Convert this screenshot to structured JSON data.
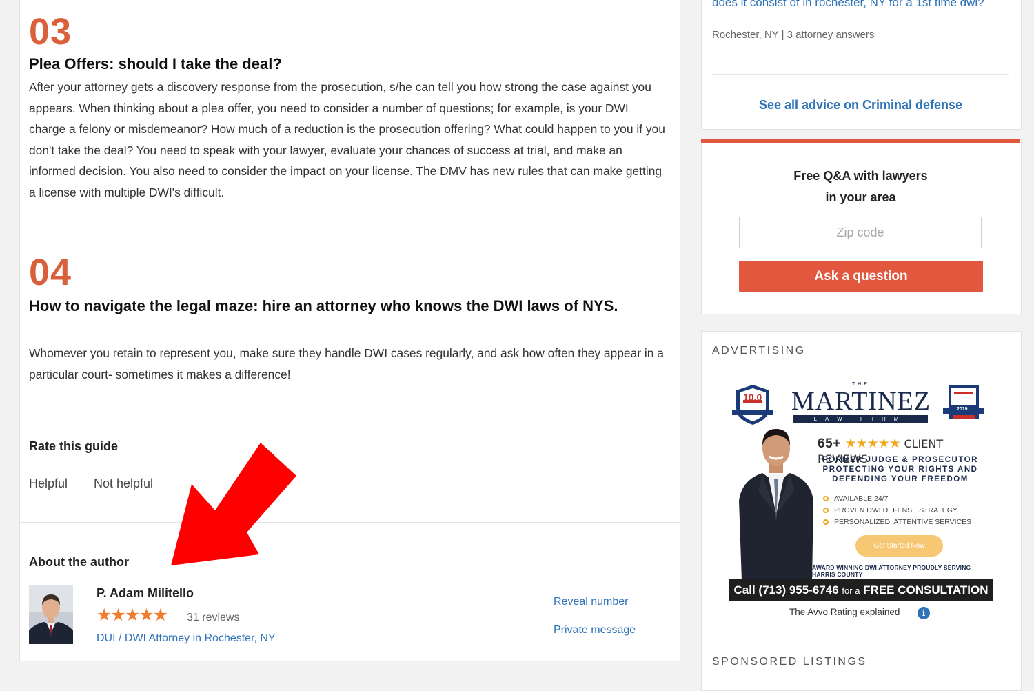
{
  "steps": [
    {
      "number": "03",
      "title": "Plea Offers: should I take the deal?",
      "body": "After your attorney gets a discovery response from the prosecution, s/he can tell you how strong the case against you appears. When thinking about a plea offer, you need to consider a number of questions; for example, is your DWI charge a felony or misdemeanor? How much of a reduction is the prosecution offering? What could happen to you if you don't take the deal? You need to speak with your lawyer, evaluate your chances of success at trial, and make an informed decision. You also need to consider the impact on your license. The DMV has new rules that can make getting a license with multiple DWI's difficult."
    },
    {
      "number": "04",
      "title": "How to navigate the legal maze: hire an attorney who knows the DWI laws of NYS.",
      "body": "Whomever you retain to represent you, make sure they handle DWI cases regularly, and ask how often they appear in a particular court- sometimes it makes a difference!"
    }
  ],
  "rate": {
    "title": "Rate this guide",
    "helpful": "Helpful",
    "not_helpful": "Not helpful"
  },
  "author": {
    "section_title": "About the author",
    "name": "P. Adam Militello",
    "stars": "★★★★★",
    "rating": 5,
    "reviews": "31 reviews",
    "specialty_link": "DUI / DWI Attorney in Rochester, NY",
    "reveal_number": "Reveal number",
    "private_message": "Private message"
  },
  "sidebar": {
    "qa_question": "does it consist of in rochester, NY for a 1st time dwi?",
    "qa_meta": "Rochester, NY | 3 attorney answers",
    "see_all": "See all advice on Criminal defense",
    "free_qa": {
      "title_line1": "Free Q&A with lawyers",
      "title_line2": "in your area",
      "zip_placeholder": "Zip code",
      "ask_button": "Ask a question"
    },
    "advertising_label": "ADVERTISING",
    "ad": {
      "the": "THE",
      "firm_name": "MARTINEZ",
      "firm_sub": "LAW FIRM",
      "badge_left": "10.0",
      "badge_right_year": "2019",
      "reviews_count": "65+",
      "reviews_stars": "★★★★★",
      "reviews_label": "CLIENT REVIEWS",
      "tagline": "FORMER JUDGE & PROSECUTOR PROTECTING YOUR RIGHTS AND DEFENDING YOUR FREEDOM",
      "bullets": [
        "AVAILABLE 24/7",
        "PROVEN DWI DEFENSE STRATEGY",
        "PERSONALIZED, ATTENTIVE SERVICES"
      ],
      "cta": "Get Started Now",
      "award": "AWARD WINNING DWI ATTORNEY PROUDLY SERVING HARRIS COUNTY",
      "call_main": "Call (713) 955-6746",
      "call_small": "for a",
      "call_end": "FREE CONSULTATION"
    },
    "avvo_rating_explained": "The Avvo Rating explained",
    "sponsored_label": "SPONSORED LISTINGS"
  },
  "colors": {
    "accent_orange": "#e2583e",
    "step_number": "#d9603b",
    "link_blue": "#2e73b8",
    "star": "#ef7d2d",
    "annotation_red": "#ff0000"
  }
}
